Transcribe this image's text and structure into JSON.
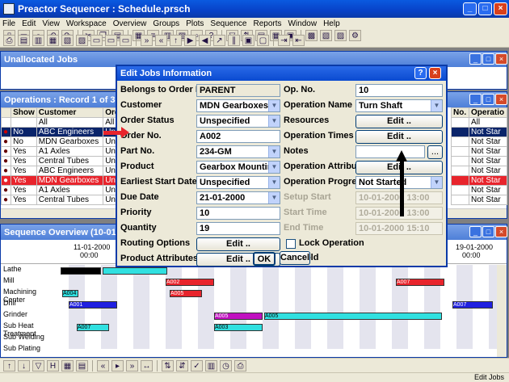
{
  "app": {
    "title": "Preactor Sequencer : Schedule.prsch"
  },
  "menu": [
    "File",
    "Edit",
    "View",
    "Workspace",
    "Overview",
    "Groups",
    "Plots",
    "Sequence",
    "Reports",
    "Window",
    "Help"
  ],
  "toolbar1": [
    "new",
    "open",
    "save",
    "undo",
    "redo",
    "cut",
    "copy",
    "paste",
    "grid",
    "gantt",
    "table",
    "chart",
    "find",
    "help",
    "filter",
    "sort",
    "arrange",
    "sequence",
    "zoom",
    "pan",
    "plot",
    "report",
    "print",
    "preview",
    "setup"
  ],
  "toolbar2": [
    "print",
    "jobs",
    "orders",
    "resources",
    "calendar",
    "timeline",
    "view1",
    "view2",
    "view3",
    "forward",
    "backward",
    "priority",
    "schedule",
    "unscheduled",
    "dispatch",
    "parallel",
    "lock",
    "unlock",
    "table",
    "export",
    "import"
  ],
  "unallocated": {
    "title": "Unallocated Jobs"
  },
  "operations": {
    "title": "Operations : Record 1 of 38",
    "columns": [
      "Show",
      "Customer",
      "Ord"
    ],
    "filters": [
      "All",
      "All"
    ],
    "right_columns": [
      "No.",
      "Operatio"
    ],
    "right_filter": "All",
    "rows": [
      {
        "show": "No",
        "customer": "ABC Engineers",
        "ord": "Uns",
        "status": "Not Star"
      },
      {
        "show": "No",
        "customer": "MDN Gearboxes",
        "ord": "Uns",
        "status": "Not Star"
      },
      {
        "show": "Yes",
        "customer": "A1 Axles",
        "ord": "Uns",
        "status": "Not Star"
      },
      {
        "show": "Yes",
        "customer": "Central Tubes",
        "ord": "Uns",
        "status": "Not Star"
      },
      {
        "show": "Yes",
        "customer": "ABC Engineers",
        "ord": "Uns",
        "status": "Not Star"
      },
      {
        "show": "Yes",
        "customer": "MDN Gearboxes",
        "ord": "Uns",
        "status": "Not Star"
      },
      {
        "show": "Yes",
        "customer": "A1 Axles",
        "ord": "Uns",
        "status": "Not Star"
      },
      {
        "show": "Yes",
        "customer": "Central Tubes",
        "ord": "Uns",
        "status": "Not Star"
      }
    ]
  },
  "sequence": {
    "title": "Sequence Overview   (10-01-2000",
    "date_left": "11-01-2000",
    "time_left": "00:00",
    "date_right": "19-01-2000",
    "time_right": "00:00",
    "resources": [
      "Lathe",
      "Mill",
      "Machining Center",
      "Drill",
      "Grinder",
      "Sub Heat Treatment",
      "Sub Welding",
      "Sub Plating"
    ],
    "bar_labels": {
      "b1": "A002",
      "b2": "A007",
      "b3": "A004",
      "b4": "A005",
      "b5": "A001",
      "b6": "A005",
      "b7": "A005",
      "b8": "A007",
      "b9": "A003",
      "b10": "A007"
    }
  },
  "dialog": {
    "title": "Edit Jobs Information",
    "labels": {
      "belongs": "Belongs to Order No.",
      "customer": "Customer",
      "order_status": "Order Status",
      "order_no": "Order No.",
      "part_no": "Part No.",
      "product": "Product",
      "earliest": "Earliest Start Date",
      "due": "Due Date",
      "priority": "Priority",
      "quantity": "Quantity",
      "routing": "Routing Options",
      "prod_attr": "Product Attributes",
      "op_no": "Op. No.",
      "op_name": "Operation Name",
      "resources": "Resources",
      "op_times": "Operation Times",
      "notes": "Notes",
      "op_attr": "Operation Attributes",
      "op_progress": "Operation Progress",
      "setup_start": "Setup Start",
      "start_time": "Start Time",
      "end_time": "End Time",
      "lock": "Lock Operation",
      "hold": "Hold"
    },
    "values": {
      "belongs": "PARENT",
      "customer": "MDN Gearboxes",
      "order_status": "Unspecified",
      "order_no": "A002",
      "part_no": "234-GM",
      "product": "Gearbox Mounting",
      "earliest": "Unspecified",
      "due": "21-01-2000",
      "priority": "10",
      "quantity": "19",
      "op_no": "10",
      "op_name": "Turn Shaft",
      "op_progress": "Not Started",
      "setup_start": "10-01-2000 13:00",
      "start_time": "10-01-2000 13:00",
      "end_time": "10-01-2000 15:10"
    },
    "buttons": {
      "edit": "Edit ..",
      "ok": "OK",
      "cancel": "Cancel",
      "notes": "..."
    }
  },
  "statusbar": {
    "text": "Edit Jobs"
  },
  "colors": {
    "accent": "#0a4ad0",
    "highlight": "#e8242c",
    "selection": "#0a246a"
  }
}
